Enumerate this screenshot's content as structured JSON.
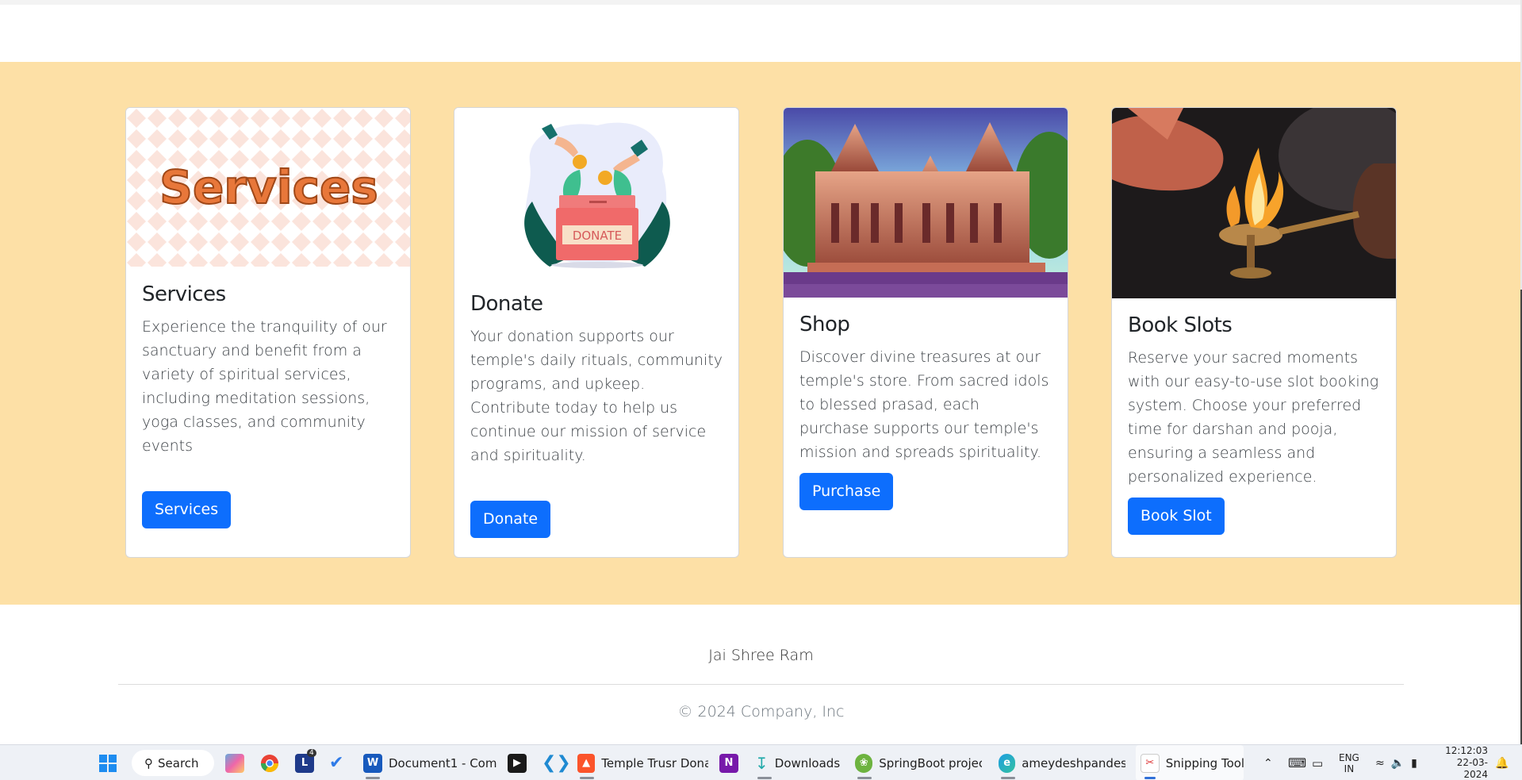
{
  "cards": [
    {
      "title": "Services",
      "text": "Experience the tranquility of our sanctuary and benefit from a variety of spiritual services, including meditation sessions, yoga classes, and community events",
      "button": "Services",
      "image_text": "Services"
    },
    {
      "title": "Donate",
      "text": "Your donation supports our temple's daily rituals, community programs, and upkeep. Contribute today to help us continue our mission of service and spirituality.",
      "button": "Donate",
      "image_text": "DONATE"
    },
    {
      "title": "Shop",
      "text": "Discover divine treasures at our temple's store. From sacred idols to blessed prasad, each purchase supports our temple's mission and spreads spirituality.",
      "button": "Purchase"
    },
    {
      "title": "Book Slots",
      "text": "Reserve your sacred moments with our easy-to-use slot booking system. Choose your preferred time for darshan and pooja, ensuring a seamless and personalized experience.",
      "button": "Book Slot"
    }
  ],
  "footer": {
    "quote": "Jai Shree Ram",
    "copyright": "© 2024 Company, Inc"
  },
  "colors": {
    "band": "#fde0a6",
    "button": "#0d6efd"
  },
  "taskbar": {
    "search": "Search",
    "badge_count": "4",
    "items": [
      {
        "label": "Document1 - Com",
        "icon": "word-icon"
      },
      {
        "label": "Temple Trusr Donat",
        "icon": "brave-icon"
      },
      {
        "label": "Downloads",
        "icon": "download-icon"
      },
      {
        "label": "SpringBoot project",
        "icon": "springboot-icon"
      },
      {
        "label": "ameydeshpandesyr",
        "icon": "edge-icon"
      },
      {
        "label": "Snipping Tool",
        "icon": "snipping-tool-icon"
      }
    ],
    "lang_top": "ENG",
    "lang_bottom": "IN",
    "time": "12:12:03",
    "date": "22-03-2024"
  }
}
